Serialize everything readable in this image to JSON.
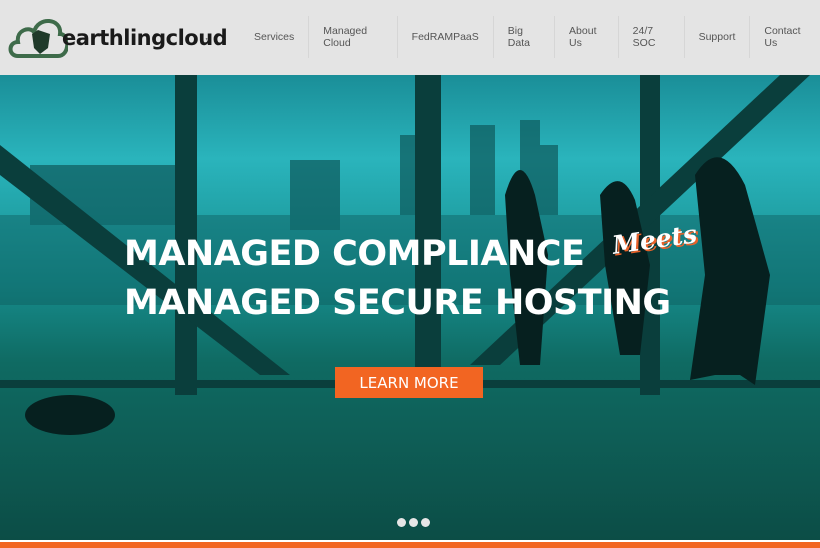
{
  "brand": {
    "name": "earthlingcloud",
    "tm": "™"
  },
  "nav": {
    "items": [
      "Services",
      "Managed Cloud",
      "FedRAMPaaS",
      "Big Data",
      "About Us",
      "24/7 SOC",
      "Support",
      "Contact Us"
    ]
  },
  "hero": {
    "line1": "MANAGED COMPLIANCE",
    "meets": "Meets",
    "line2": "MANAGED SECURE HOSTING",
    "cta": "LEARN MORE",
    "slides": 3
  },
  "colors": {
    "accent": "#f26522",
    "hero_tint": "#1a9ea4",
    "header_bg": "#e4e4e4"
  }
}
